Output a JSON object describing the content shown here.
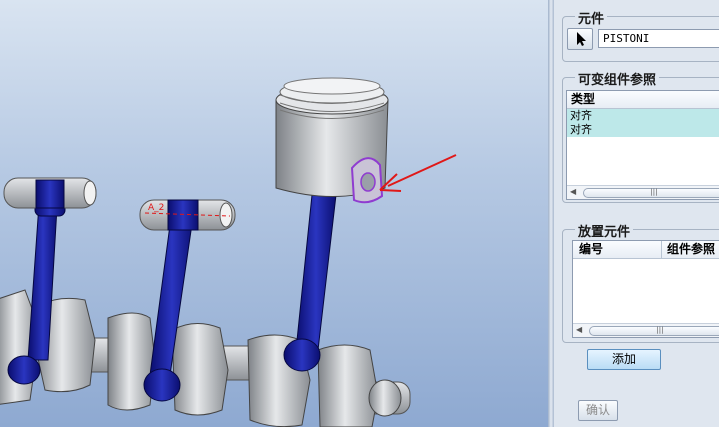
{
  "component": {
    "title": "元件",
    "name_value": "PISTONI"
  },
  "variable_refs": {
    "title": "可变组件参照",
    "column_header": "类型",
    "rows": [
      "对齐",
      "对齐"
    ]
  },
  "place_component": {
    "title": "放置元件",
    "col_number": "编号",
    "col_component_ref": "组件参照"
  },
  "buttons": {
    "add": "添加",
    "confirm": "确认"
  },
  "viewport": {
    "dimension_label": "A_2"
  },
  "colors": {
    "rod_blue": "#14188f",
    "metal_grey": "#b9bcc0",
    "arrow_red": "#e01818",
    "highlight_purple": "#8f3cd0",
    "list_highlight": "#bde8e9"
  }
}
